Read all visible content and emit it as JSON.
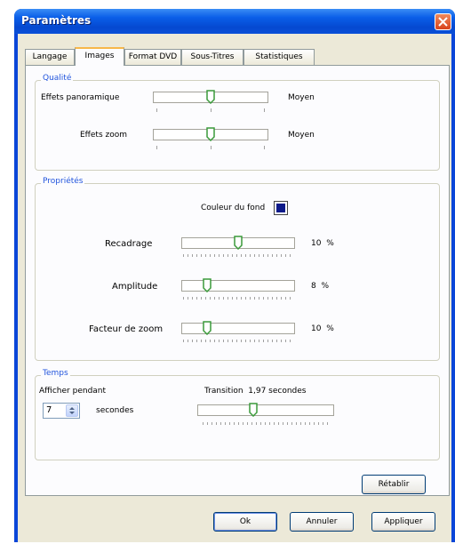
{
  "window": {
    "title": "Paramètres"
  },
  "tabs": [
    {
      "label": "Langage"
    },
    {
      "label": "Images"
    },
    {
      "label": "Format DVD"
    },
    {
      "label": "Sous-Titres"
    },
    {
      "label": "Statistiques"
    }
  ],
  "quality": {
    "title": "Qualité",
    "pan": {
      "label": "Effets panoramique",
      "value": "Moyen",
      "level": 0.5
    },
    "zoom": {
      "label": "Effets zoom",
      "value": "Moyen",
      "level": 0.5
    }
  },
  "properties": {
    "title": "Propriétés",
    "bg_color_label": "Couleur du fond",
    "bg_color": "#0d1a8a",
    "crop": {
      "label": "Recadrage",
      "value": "10",
      "unit": "%",
      "level": 0.5
    },
    "amplitude": {
      "label": "Amplitude",
      "value": "8",
      "unit": "%",
      "level": 0.2
    },
    "zoom_factor": {
      "label": "Facteur de zoom",
      "value": "10",
      "unit": "%",
      "level": 0.2
    }
  },
  "time": {
    "title": "Temps",
    "display_label": "Afficher pendant",
    "seconds_value": "7",
    "seconds_label": "secondes",
    "transition_label": "Transition",
    "transition_value": "1,97 secondes",
    "level": 0.4
  },
  "buttons": {
    "reset": "Rétablir",
    "ok": "Ok",
    "cancel": "Annuler",
    "apply": "Appliquer"
  },
  "colors": {
    "title_bar": "#0a5ee8",
    "group_title": "#2255dd",
    "thumb": "#3a9a3a"
  }
}
